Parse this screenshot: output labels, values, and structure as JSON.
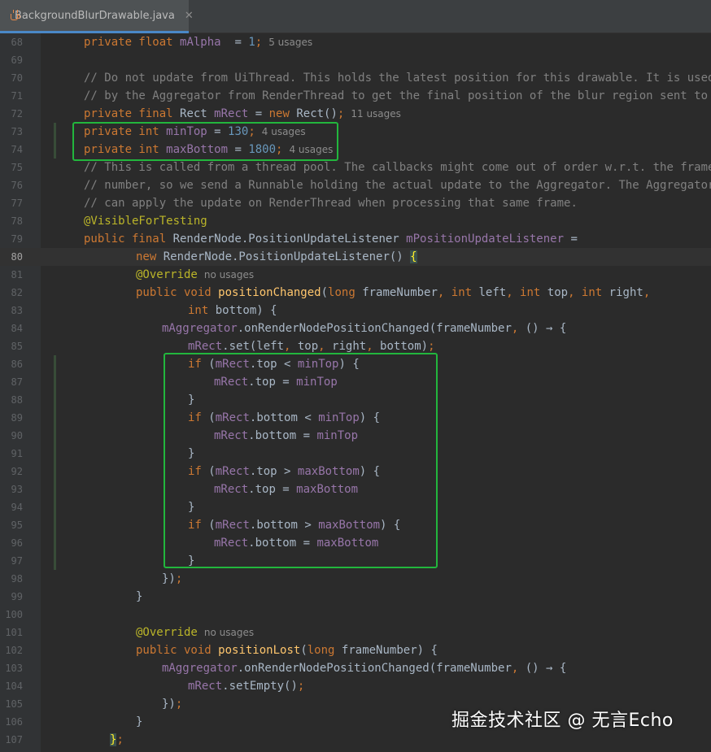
{
  "tab": {
    "filename": "BackgroundBlurDrawable.java",
    "close": "✕",
    "icon": "java-cup-icon",
    "accent": "#4a88c7"
  },
  "lines": [
    {
      "n": "68",
      "indent": 0,
      "t": [
        [
          "kw",
          "private float "
        ],
        [
          "field",
          "mAlpha"
        ],
        [
          "",
          "  = "
        ],
        [
          "num",
          "1"
        ],
        [
          "kw",
          ";"
        ],
        [
          "hint",
          "5 usages"
        ]
      ]
    },
    {
      "n": "69",
      "indent": 0,
      "t": []
    },
    {
      "n": "70",
      "indent": 0,
      "t": [
        [
          "cmt",
          "// Do not update from UiThread. This holds the latest position for this drawable. It is used"
        ]
      ]
    },
    {
      "n": "71",
      "indent": 0,
      "t": [
        [
          "cmt",
          "// by the Aggregator from RenderThread to get the final position of the blur region sent to SF"
        ]
      ]
    },
    {
      "n": "72",
      "indent": 0,
      "t": [
        [
          "kw",
          "private final "
        ],
        [
          "",
          "Rect "
        ],
        [
          "field",
          "mRect"
        ],
        [
          "",
          " = "
        ],
        [
          "kw",
          "new "
        ],
        [
          "",
          "Rect()"
        ],
        [
          "kw",
          ";"
        ],
        [
          "hint",
          "11 usages"
        ]
      ]
    },
    {
      "n": "73",
      "indent": 0,
      "t": [
        [
          "kw",
          "private int "
        ],
        [
          "field",
          "minTop"
        ],
        [
          "",
          " = "
        ],
        [
          "num",
          "130"
        ],
        [
          "kw",
          ";"
        ],
        [
          "hint",
          "4 usages"
        ]
      ]
    },
    {
      "n": "74",
      "indent": 0,
      "t": [
        [
          "kw",
          "private int "
        ],
        [
          "field",
          "maxBottom"
        ],
        [
          "",
          " = "
        ],
        [
          "num",
          "1800"
        ],
        [
          "kw",
          ";"
        ],
        [
          "hint",
          "4 usages"
        ]
      ]
    },
    {
      "n": "75",
      "indent": 0,
      "t": [
        [
          "cmt",
          "// This is called from a thread pool. The callbacks might come out of order w.r.t. the frame"
        ]
      ]
    },
    {
      "n": "76",
      "indent": 0,
      "t": [
        [
          "cmt",
          "// number, so we send a Runnable holding the actual update to the Aggregator. The Aggregator"
        ]
      ]
    },
    {
      "n": "77",
      "indent": 0,
      "t": [
        [
          "cmt",
          "// can apply the update on RenderThread when processing that same frame."
        ]
      ]
    },
    {
      "n": "78",
      "indent": 0,
      "t": [
        [
          "ann",
          "@VisibleForTesting"
        ]
      ]
    },
    {
      "n": "79",
      "indent": 0,
      "t": [
        [
          "kw",
          "public final "
        ],
        [
          "",
          "RenderNode.PositionUpdateListener "
        ],
        [
          "field",
          "mPositionUpdateListener"
        ],
        [
          "",
          " ="
        ]
      ]
    },
    {
      "n": "80",
      "indent": 2,
      "current": true,
      "t": [
        [
          "kw",
          "new "
        ],
        [
          "",
          "RenderNode.PositionUpdateListener() "
        ],
        [
          "brace",
          "{"
        ]
      ]
    },
    {
      "n": "81",
      "indent": 2,
      "t": [
        [
          "ann",
          "@Override"
        ],
        [
          "hint",
          "no usages"
        ]
      ]
    },
    {
      "n": "82",
      "indent": 2,
      "t": [
        [
          "kw",
          "public void "
        ],
        [
          "fn",
          "positionChanged"
        ],
        [
          "",
          "("
        ],
        [
          "kw",
          "long "
        ],
        [
          "",
          "frameNumber"
        ],
        [
          "kw",
          ", int "
        ],
        [
          "",
          "left"
        ],
        [
          "kw",
          ", int "
        ],
        [
          "",
          "top"
        ],
        [
          "kw",
          ", int "
        ],
        [
          "",
          "right"
        ],
        [
          "kw",
          ","
        ]
      ]
    },
    {
      "n": "83",
      "indent": 4,
      "t": [
        [
          "kw",
          "int "
        ],
        [
          "",
          "bottom) {"
        ]
      ]
    },
    {
      "n": "84",
      "indent": 3,
      "t": [
        [
          "field",
          "mAggregator"
        ],
        [
          "",
          ".onRenderNodePositionChanged(frameNumber"
        ],
        [
          "kw",
          ", "
        ],
        [
          "",
          "() → {"
        ]
      ]
    },
    {
      "n": "85",
      "indent": 4,
      "t": [
        [
          "field",
          "mRect"
        ],
        [
          "",
          ".set(left"
        ],
        [
          "kw",
          ", "
        ],
        [
          "",
          "top"
        ],
        [
          "kw",
          ", "
        ],
        [
          "",
          "right"
        ],
        [
          "kw",
          ", "
        ],
        [
          "",
          "bottom)"
        ],
        [
          "kw",
          ";"
        ]
      ]
    },
    {
      "n": "86",
      "indent": 4,
      "t": [
        [
          "kw",
          "if "
        ],
        [
          "",
          "("
        ],
        [
          "field",
          "mRect"
        ],
        [
          "",
          ".top < "
        ],
        [
          "field",
          "minTop"
        ],
        [
          "",
          ") {"
        ]
      ]
    },
    {
      "n": "87",
      "indent": 5,
      "t": [
        [
          "field",
          "mRect"
        ],
        [
          "",
          ".top = "
        ],
        [
          "field",
          "minTop"
        ]
      ]
    },
    {
      "n": "88",
      "indent": 4,
      "t": [
        [
          "",
          "}"
        ]
      ]
    },
    {
      "n": "89",
      "indent": 4,
      "t": [
        [
          "kw",
          "if "
        ],
        [
          "",
          "("
        ],
        [
          "field",
          "mRect"
        ],
        [
          "",
          ".bottom < "
        ],
        [
          "field",
          "minTop"
        ],
        [
          "",
          ") {"
        ]
      ]
    },
    {
      "n": "90",
      "indent": 5,
      "t": [
        [
          "field",
          "mRect"
        ],
        [
          "",
          ".bottom = "
        ],
        [
          "field",
          "minTop"
        ]
      ]
    },
    {
      "n": "91",
      "indent": 4,
      "t": [
        [
          "",
          "}"
        ]
      ]
    },
    {
      "n": "92",
      "indent": 4,
      "t": [
        [
          "kw",
          "if "
        ],
        [
          "",
          "("
        ],
        [
          "field",
          "mRect"
        ],
        [
          "",
          ".top > "
        ],
        [
          "field",
          "maxBottom"
        ],
        [
          "",
          ") {"
        ]
      ]
    },
    {
      "n": "93",
      "indent": 5,
      "t": [
        [
          "field",
          "mRect"
        ],
        [
          "",
          ".top = "
        ],
        [
          "field",
          "maxBottom"
        ]
      ]
    },
    {
      "n": "94",
      "indent": 4,
      "t": [
        [
          "",
          "}"
        ]
      ]
    },
    {
      "n": "95",
      "indent": 4,
      "t": [
        [
          "kw",
          "if "
        ],
        [
          "",
          "("
        ],
        [
          "field",
          "mRect"
        ],
        [
          "",
          ".bottom > "
        ],
        [
          "field",
          "maxBottom"
        ],
        [
          "",
          ") {"
        ]
      ]
    },
    {
      "n": "96",
      "indent": 5,
      "t": [
        [
          "field",
          "mRect"
        ],
        [
          "",
          ".bottom = "
        ],
        [
          "field",
          "maxBottom"
        ]
      ]
    },
    {
      "n": "97",
      "indent": 4,
      "t": [
        [
          "",
          "}"
        ]
      ]
    },
    {
      "n": "98",
      "indent": 3,
      "t": [
        [
          "",
          "})"
        ],
        [
          "kw",
          ";"
        ]
      ]
    },
    {
      "n": "99",
      "indent": 2,
      "t": [
        [
          "",
          "}"
        ]
      ]
    },
    {
      "n": "100",
      "indent": 0,
      "t": []
    },
    {
      "n": "101",
      "indent": 2,
      "t": [
        [
          "ann",
          "@Override"
        ],
        [
          "hint",
          "no usages"
        ]
      ]
    },
    {
      "n": "102",
      "indent": 2,
      "t": [
        [
          "kw",
          "public void "
        ],
        [
          "fn",
          "positionLost"
        ],
        [
          "",
          "("
        ],
        [
          "kw",
          "long "
        ],
        [
          "",
          "frameNumber) {"
        ]
      ]
    },
    {
      "n": "103",
      "indent": 3,
      "t": [
        [
          "field",
          "mAggregator"
        ],
        [
          "",
          ".onRenderNodePositionChanged(frameNumber"
        ],
        [
          "kw",
          ", "
        ],
        [
          "",
          "() → {"
        ]
      ]
    },
    {
      "n": "104",
      "indent": 4,
      "t": [
        [
          "field",
          "mRect"
        ],
        [
          "",
          ".setEmpty()"
        ],
        [
          "kw",
          ";"
        ]
      ]
    },
    {
      "n": "105",
      "indent": 3,
      "t": [
        [
          "",
          "})"
        ],
        [
          "kw",
          ";"
        ]
      ]
    },
    {
      "n": "106",
      "indent": 2,
      "t": [
        [
          "",
          "}"
        ]
      ]
    },
    {
      "n": "107",
      "indent": 1,
      "t": [
        [
          "brace",
          "}"
        ],
        [
          "kw",
          ";"
        ]
      ]
    }
  ],
  "watermark": "掘金技术社区 @ 无言Echo",
  "colors": {
    "background": "#2b2b2b",
    "keyword": "#cc7832",
    "number": "#6897bb",
    "field": "#9876aa",
    "comment": "#808080",
    "annotation": "#bbb529",
    "method": "#ffc66d",
    "highlight_box": "#22b63d"
  }
}
